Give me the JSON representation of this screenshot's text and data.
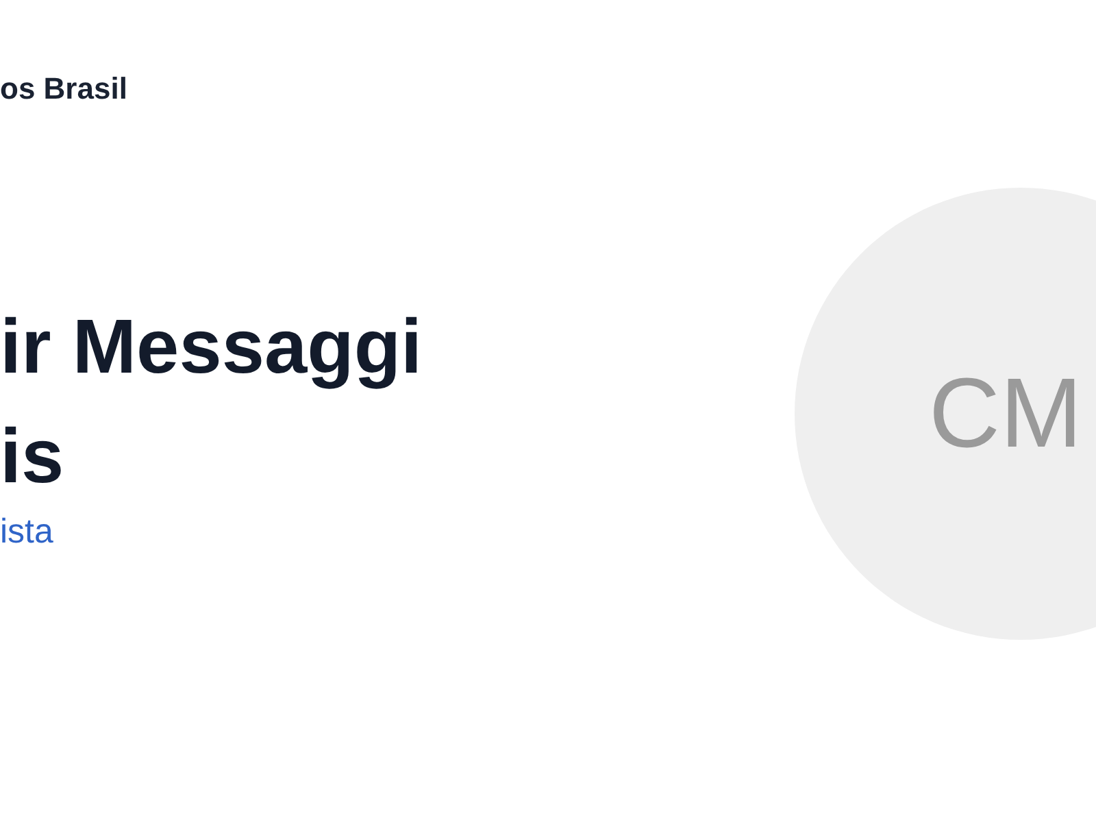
{
  "header": {
    "brand": "os Brasil"
  },
  "profile": {
    "name_lines": [
      "ir Messaggi",
      "is"
    ],
    "role": "ista",
    "avatar_initials": "CM"
  }
}
